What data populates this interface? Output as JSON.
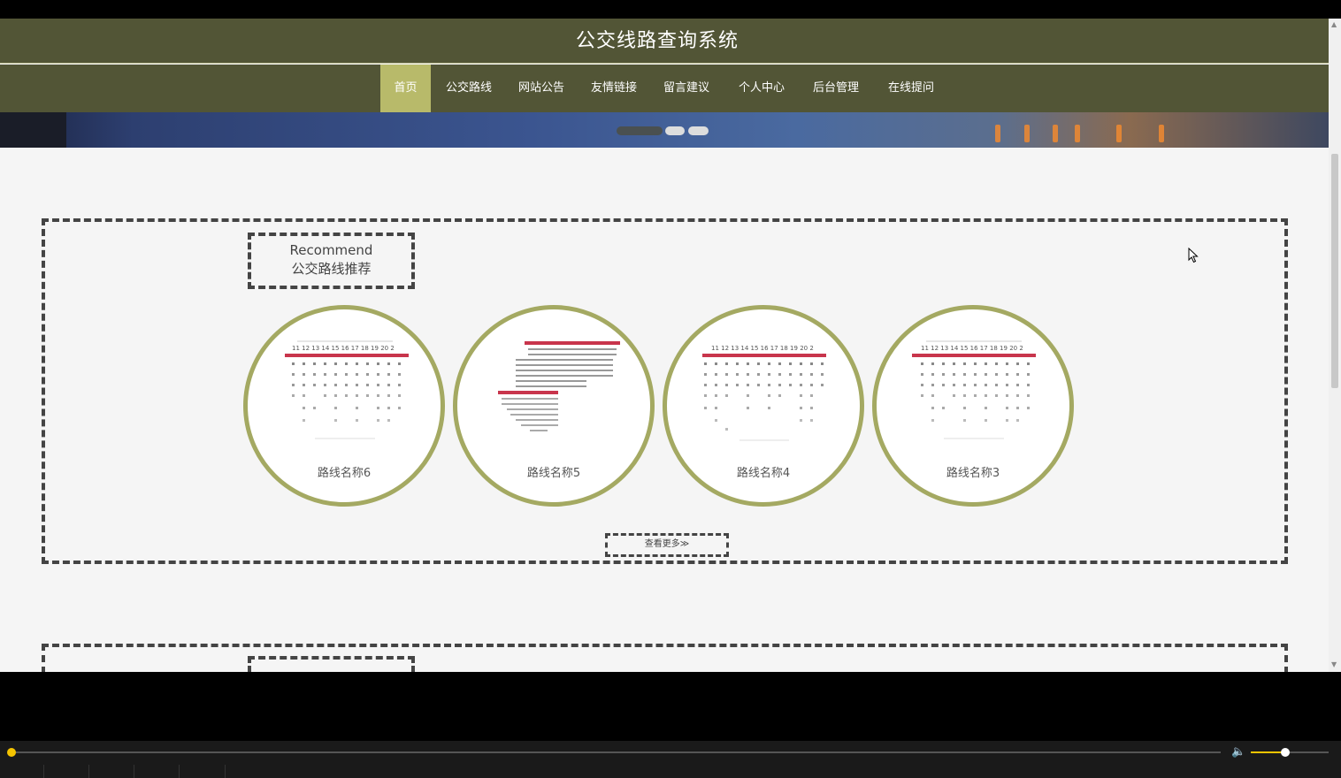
{
  "header": {
    "title": "公交线路查询系统"
  },
  "nav": {
    "items": [
      {
        "label": "首页",
        "active": true
      },
      {
        "label": "公交路线",
        "active": false
      },
      {
        "label": "网站公告",
        "active": false
      },
      {
        "label": "友情链接",
        "active": false
      },
      {
        "label": "留言建议",
        "active": false
      },
      {
        "label": "个人中心",
        "active": false
      },
      {
        "label": "后台管理",
        "active": false
      },
      {
        "label": "在线提问",
        "active": false
      }
    ]
  },
  "banner": {
    "slides": 3,
    "active_slide": 1
  },
  "recommend": {
    "title_en": "Recommend",
    "title_cn": "公交路线推荐",
    "routes": [
      {
        "name": "路线名称6"
      },
      {
        "name": "路线名称5"
      },
      {
        "name": "路线名称4"
      },
      {
        "name": "路线名称3"
      }
    ],
    "more_label": "查看更多≫"
  },
  "colors": {
    "header_bg": "#525536",
    "nav_active": "#b8ba6a",
    "card_border": "#a4a962",
    "player_accent": "#f5c400"
  },
  "player": {
    "progress": 0.0,
    "volume": 0.45
  }
}
